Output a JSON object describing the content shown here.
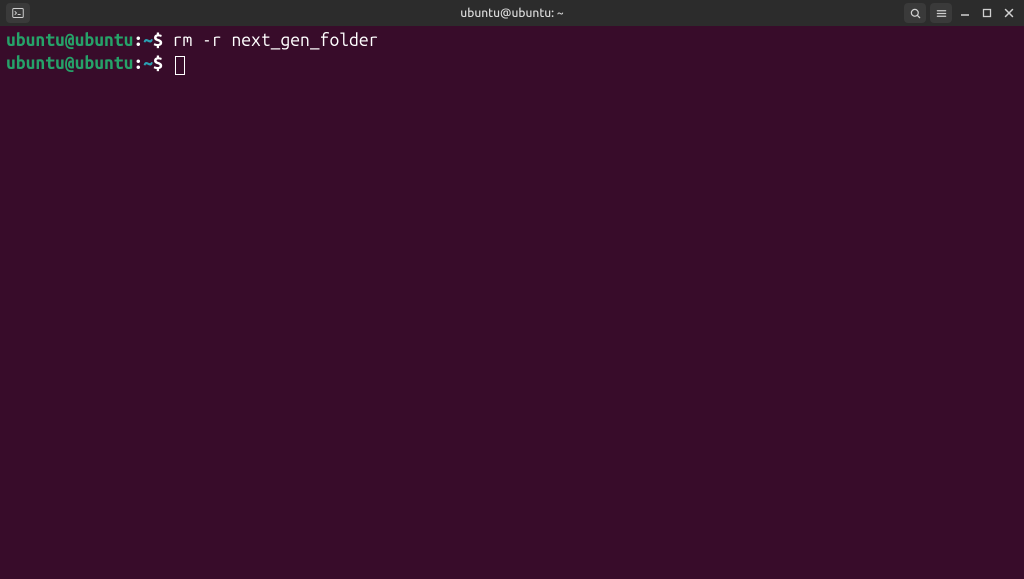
{
  "titlebar": {
    "title": "ubuntu@ubuntu: ~"
  },
  "terminal": {
    "lines": [
      {
        "user_host": "ubuntu@ubuntu",
        "colon": ":",
        "path": "~",
        "dollar": "$ ",
        "command": "rm -r next_gen_folder"
      },
      {
        "user_host": "ubuntu@ubuntu",
        "colon": ":",
        "path": "~",
        "dollar": "$ ",
        "command": ""
      }
    ]
  }
}
